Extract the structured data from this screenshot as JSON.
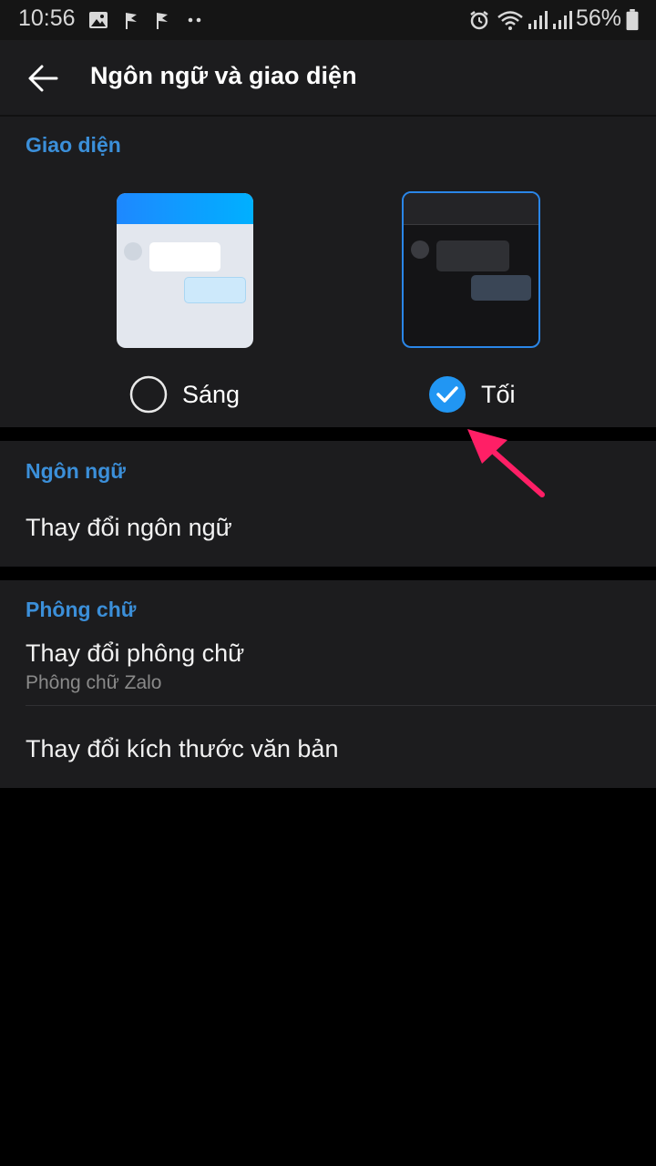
{
  "status_bar": {
    "time": "10:56",
    "battery": "56%",
    "icons": [
      "gallery-icon",
      "flag-icon",
      "flag-icon",
      "more-dots-icon",
      "alarm-icon",
      "wifi-icon",
      "signal-icon",
      "signal-icon",
      "battery-icon"
    ]
  },
  "app_bar": {
    "title": "Ngôn ngữ và giao diện",
    "back_icon": "arrow-left-icon"
  },
  "theme_section": {
    "header": "Giao diện",
    "options": [
      {
        "label": "Sáng",
        "selected": false
      },
      {
        "label": "Tối",
        "selected": true
      }
    ]
  },
  "language_section": {
    "header": "Ngôn ngữ",
    "item": "Thay đổi ngôn ngữ"
  },
  "font_section": {
    "header": "Phông chữ",
    "change_font": "Thay đổi phông chữ",
    "current_font": "Phông chữ Zalo",
    "change_size": "Thay đổi kích thước văn bản"
  },
  "colors": {
    "accent": "#3b8fd9",
    "check_blue": "#2196f3",
    "arrow_pink": "#ff1f66"
  }
}
